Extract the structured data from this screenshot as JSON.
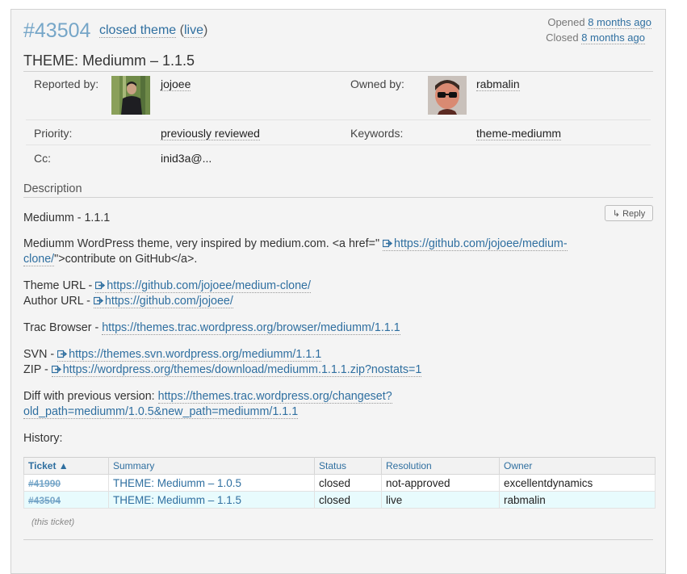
{
  "ticket": {
    "number": "#43504",
    "status": "closed",
    "type": "theme",
    "resolution": "live",
    "title": "THEME: Mediumm – 1.1.5",
    "opened_label": "Opened",
    "opened_ago": "8 months ago",
    "closed_label": "Closed",
    "closed_ago": "8 months ago"
  },
  "properties": {
    "reported_by_label": "Reported by:",
    "reported_by": "jojoee",
    "owned_by_label": "Owned by:",
    "owned_by": "rabmalin",
    "priority_label": "Priority:",
    "priority": "previously reviewed",
    "keywords_label": "Keywords:",
    "keywords": "theme-mediumm",
    "cc_label": "Cc:",
    "cc": "inid3a@..."
  },
  "description": {
    "heading": "Description",
    "reply_label": "↳ Reply",
    "version_line": "Mediumm - 1.1.1",
    "intro_text_1": "Mediumm WordPress theme, very inspired by medium.com. <a href=\"",
    "intro_link_1": "https://github.com/jojoee/medium-",
    "intro_link_2": "clone/",
    "intro_text_2": "\">contribute on GitHub</a>.",
    "theme_url_label": "Theme URL -",
    "theme_url": "https://github.com/jojoee/medium-clone/",
    "author_url_label": "Author URL -",
    "author_url": "https://github.com/jojoee/",
    "trac_label": "Trac Browser -",
    "trac_url": "https://themes.trac.wordpress.org/browser/mediumm/1.1.1",
    "svn_label": "SVN -",
    "svn_url": "https://themes.svn.wordpress.org/mediumm/1.1.1",
    "zip_label": "ZIP -",
    "zip_url": "https://wordpress.org/themes/download/mediumm.1.1.1.zip?nostats=1",
    "diff_label": "Diff with previous version:",
    "diff_url_1": "https://themes.trac.wordpress.org/changeset?",
    "diff_url_2": "old_path=mediumm/1.0.5&new_path=mediumm/1.1.1",
    "history_label": "History:"
  },
  "history": {
    "columns": [
      "Ticket ▲",
      "Summary",
      "Status",
      "Resolution",
      "Owner"
    ],
    "rows": [
      {
        "ticket": "#41990",
        "summary": "THEME: Mediumm – 1.0.5",
        "status": "closed",
        "resolution": "not-approved",
        "owner": "excellentdynamics"
      },
      {
        "ticket": "#43504",
        "summary": "THEME: Mediumm – 1.1.5",
        "status": "closed",
        "resolution": "live",
        "owner": "rabmalin"
      }
    ],
    "note": "(this ticket)"
  },
  "colors": {
    "link": "#2f6fa0",
    "ticket_number": "#76a6c8",
    "current_row": "#e8fbfd",
    "panel_bg": "#f4f4f4"
  }
}
